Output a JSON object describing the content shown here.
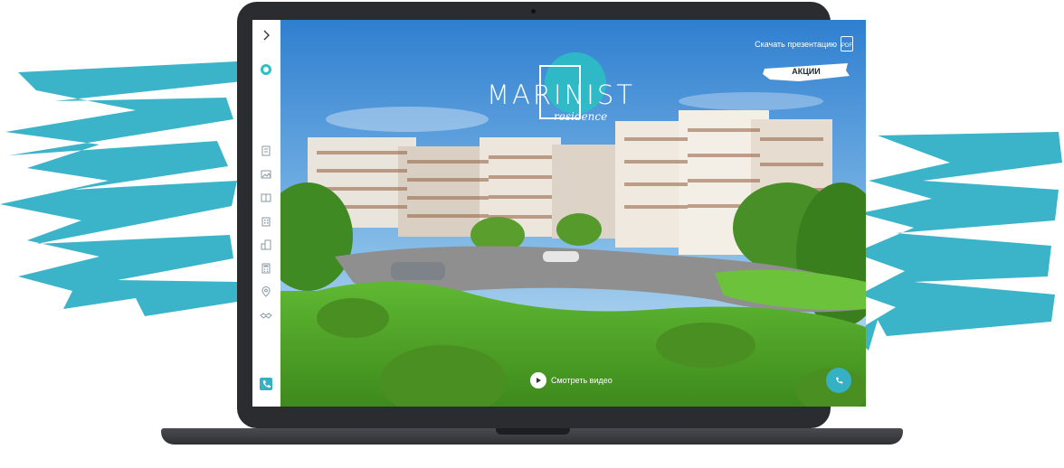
{
  "colors": {
    "brand_teal": "#2cc1c4",
    "brush_blue": "#3bb3c8",
    "call_button": "#36b0c5"
  },
  "sidebar": {
    "items": [
      {
        "icon": "chevron-right-icon"
      },
      {
        "icon": "logo-badge-icon"
      },
      {
        "icon": "document-icon"
      },
      {
        "icon": "image-icon"
      },
      {
        "icon": "floorplan-icon"
      },
      {
        "icon": "building-icon"
      },
      {
        "icon": "city-icon"
      },
      {
        "icon": "calculator-icon"
      },
      {
        "icon": "location-pin-icon"
      },
      {
        "icon": "handshake-icon"
      },
      {
        "icon": "phone-icon"
      }
    ]
  },
  "logo": {
    "title": "MARINIST",
    "subtitle": "residence"
  },
  "header": {
    "pdf_label": "Скачать презентацию",
    "pdf_badge": "PDF",
    "promo_label": "АКЦИИ"
  },
  "video": {
    "label": "Смотреть видео"
  }
}
